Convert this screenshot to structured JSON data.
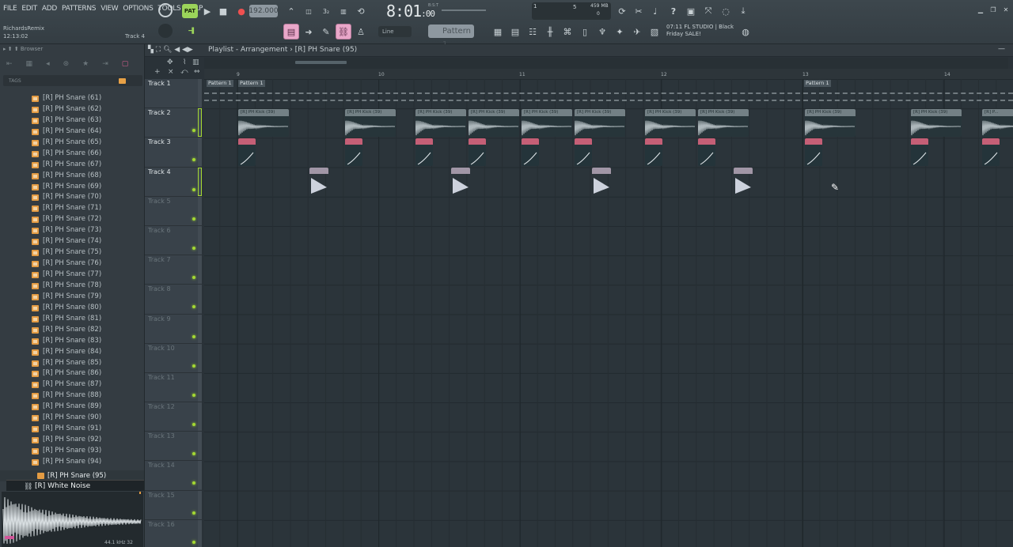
{
  "menu": [
    "FILE",
    "EDIT",
    "ADD",
    "PATTERNS",
    "VIEW",
    "OPTIONS",
    "TOOLS",
    "HELP"
  ],
  "song": {
    "name": "RichardsRemix",
    "time": "12:13:02",
    "focused_track": "Track 4"
  },
  "transport": {
    "pattern_mode": "PAT",
    "tempo": "192.000",
    "time_main": "8:01",
    "time_sub": ":00",
    "time_unit": "B:S:T"
  },
  "cpu": {
    "voices": "1",
    "polyphony": "5",
    "memory": "459 MB",
    "mem_sub": "0"
  },
  "snap": "Line",
  "pattern_selector": "Pattern 1",
  "news": {
    "line1": "07:11  FL STUDIO | Black",
    "line2": "Friday SALE!"
  },
  "browser": {
    "title": "Browser",
    "tags_label": "TAGS",
    "items": [
      "[R] PH Snare (61)",
      "[R] PH Snare (62)",
      "[R] PH Snare (63)",
      "[R] PH Snare (64)",
      "[R] PH Snare (65)",
      "[R] PH Snare (66)",
      "[R] PH Snare (67)",
      "[R] PH Snare (68)",
      "[R] PH Snare (69)",
      "[R] PH Snare (70)",
      "[R] PH Snare (71)",
      "[R] PH Snare (72)",
      "[R] PH Snare (73)",
      "[R] PH Snare (74)",
      "[R] PH Snare (75)",
      "[R] PH Snare (76)",
      "[R] PH Snare (77)",
      "[R] PH Snare (78)",
      "[R] PH Snare (79)",
      "[R] PH Snare (80)",
      "[R] PH Snare (81)",
      "[R] PH Snare (82)",
      "[R] PH Snare (83)",
      "[R] PH Snare (84)",
      "[R] PH Snare (85)",
      "[R] PH Snare (86)",
      "[R] PH Snare (87)",
      "[R] PH Snare (88)",
      "[R] PH Snare (89)",
      "[R] PH Snare (90)",
      "[R] PH Snare (91)",
      "[R] PH Snare (92)",
      "[R] PH Snare (93)",
      "[R] PH Snare (94)"
    ],
    "selected": "[R] PH Snare (95)",
    "highlighted": "[R] White Noise",
    "sample_info": "44.1 kHz 32"
  },
  "playlist": {
    "breadcrumb": "Playlist - Arrangement › [R] PH Snare (95)",
    "bars": [
      "9",
      "10",
      "11",
      "12",
      "13",
      "14"
    ],
    "tracks": [
      "Track 1",
      "Track 2",
      "Track 3",
      "Track 4",
      "Track 5",
      "Track 6",
      "Track 7",
      "Track 8",
      "Track 9",
      "Track 10",
      "Track 11",
      "Track 12",
      "Track 13",
      "Track 14",
      "Track 15",
      "Track 16"
    ],
    "pattern_labels": [
      "Pattern 1",
      "Pattern 1",
      "Pattern 1"
    ],
    "kick_label": "[R] PH Kick (39)",
    "kick_label_short": "[R] P..."
  },
  "colors": {
    "accent_green": "#a4d932",
    "kick_clip": "#738085",
    "snare_clip": "#c55f76",
    "hat_clip": "#a196a6",
    "pink_button": "#e9a7c9"
  }
}
